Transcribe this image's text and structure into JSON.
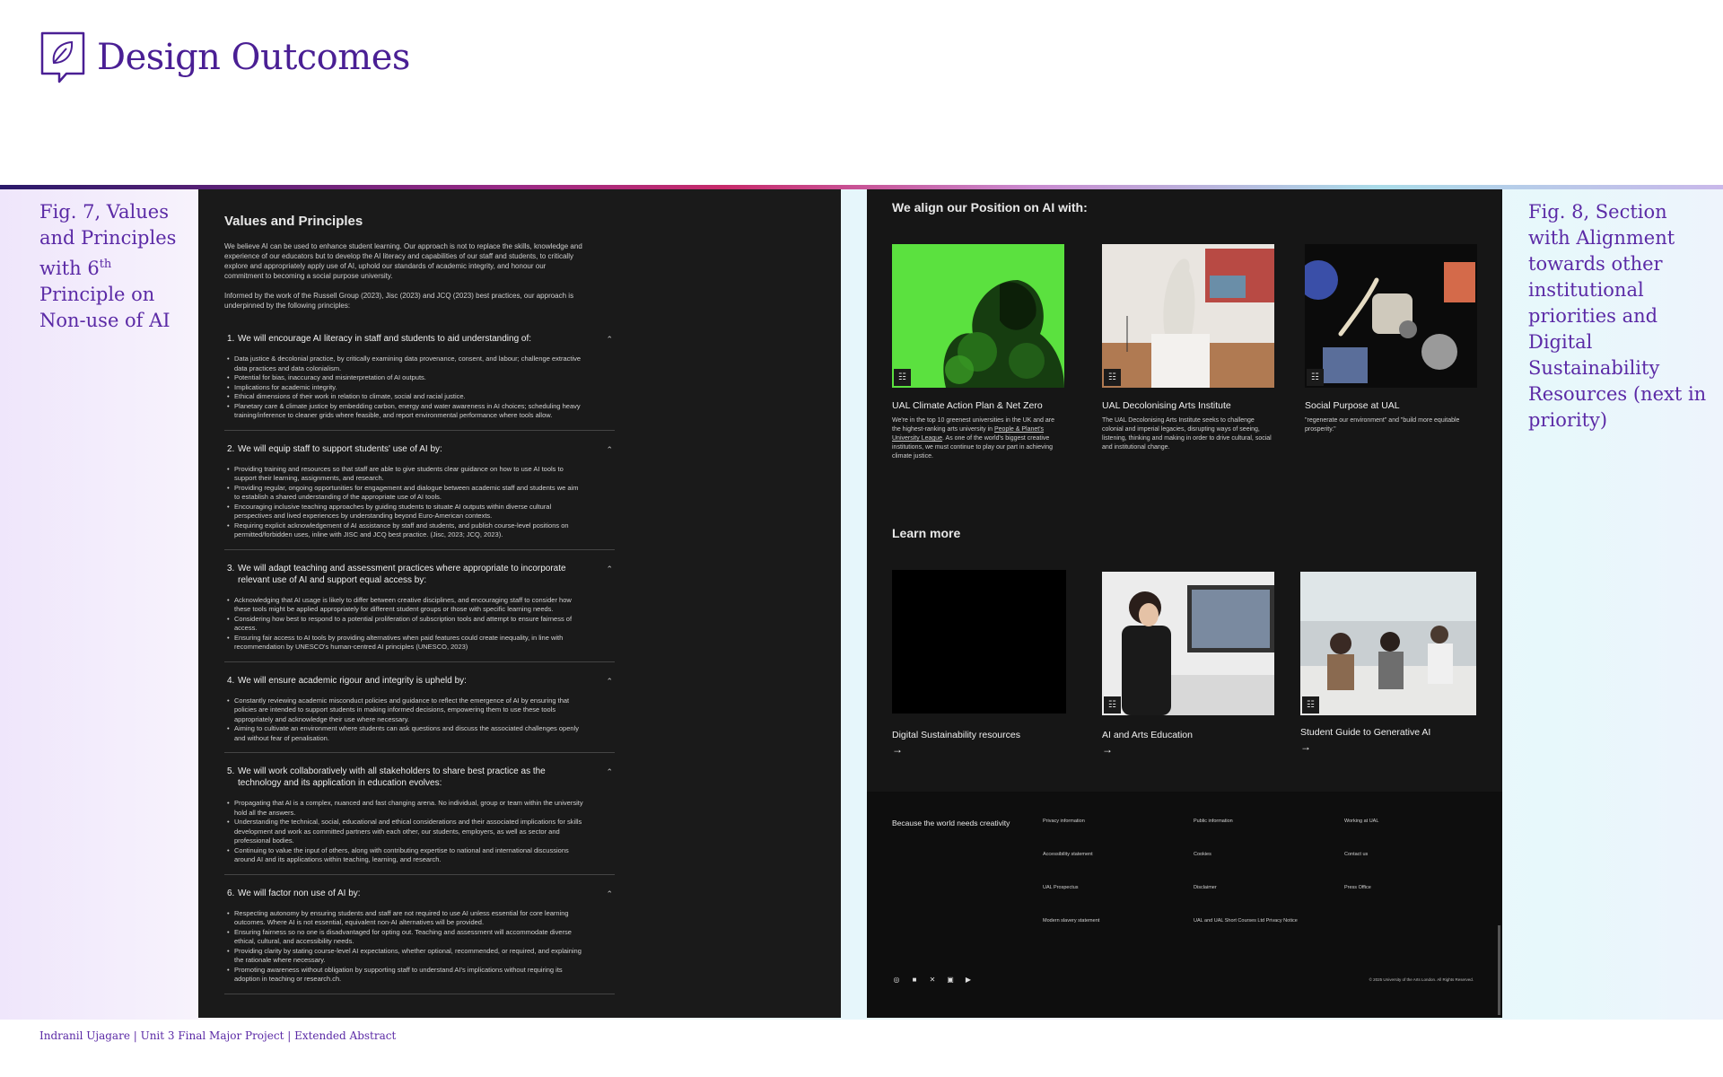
{
  "header": {
    "title": "Design Outcomes",
    "logo_icon": "leaf-speech-bubble-icon"
  },
  "captions": {
    "left": {
      "text": "Fig. 7, Values and Principles with 6",
      "sup": "th",
      "tail": " Principle on Non-use of AI"
    },
    "right": "Fig. 8, Section with Alignment towards other institutional priorities and Digital Sustainability Resources (next in priority)"
  },
  "values_page": {
    "title": "Values and Principles",
    "intro1": "We believe AI can be used to enhance student learning. Our approach is not to replace the skills, knowledge and experience of our educators but to develop the AI literacy and capabilities of our staff and students, to critically explore and appropriately apply use of AI, uphold our standards of academic integrity, and honour our commitment to becoming a social purpose university.",
    "intro2": "Informed by the work of the Russell Group (2023), Jisc (2023) and JCQ (2023) best practices, our approach is underpinned by the following principles:",
    "principles": [
      {
        "num": "1.",
        "heading": "We will encourage AI literacy in staff and students to aid understanding of:",
        "bullets": [
          "Data justice & decolonial practice, by critically examining data provenance, consent, and labour; challenge extractive data practices and data colonialism.",
          "Potential for bias, inaccuracy and misinterpretation of AI outputs.",
          "Implications for academic integrity.",
          "Ethical dimensions of their work in relation to climate, social and racial justice.",
          "Planetary care & climate justice by embedding carbon, energy and water awareness in AI choices; scheduling heavy training/inference to cleaner grids where feasible, and report environmental performance where tools allow."
        ]
      },
      {
        "num": "2.",
        "heading": "We will equip staff to support students' use of AI by:",
        "bullets": [
          "Providing training and resources so that staff are able to give students clear guidance on how to use AI tools to support their learning, assignments, and research.",
          "Providing regular, ongoing opportunities for engagement and dialogue between academic staff and students we aim to establish a shared understanding of the appropriate use of AI tools.",
          "Encouraging inclusive teaching approaches by guiding students to situate AI outputs within diverse cultural perspectives and lived experiences by understanding beyond Euro-American contexts.",
          "Requiring explicit acknowledgement of AI assistance by staff and students, and publish course-level positions on permitted/forbidden uses, inline with JISC and JCQ best practice. (Jisc, 2023; JCQ, 2023)."
        ]
      },
      {
        "num": "3.",
        "heading": "We will adapt teaching and assessment practices where appropriate to incorporate relevant use of AI and support equal access by:",
        "bullets": [
          "Acknowledging that AI usage is likely to differ between creative disciplines, and encouraging staff to consider how these tools might be applied appropriately for different student groups or those with specific learning needs.",
          "Considering how best to respond to a potential proliferation of subscription tools and attempt to ensure fairness of access.",
          "Ensuring fair access to AI tools by providing alternatives when paid features could create inequality, in line with recommendation by UNESCO's human-centred AI principles (UNESCO, 2023)"
        ]
      },
      {
        "num": "4.",
        "heading": "We will ensure academic rigour and integrity is upheld by:",
        "bullets": [
          "Constantly reviewing academic misconduct policies and guidance to reflect the emergence of AI by ensuring that policies are intended to support students in making informed decisions, empowering them to use these tools appropriately and acknowledge their use where necessary.",
          "Aiming to cultivate an environment where students can ask questions and discuss the associated challenges openly and without fear of penalisation."
        ]
      },
      {
        "num": "5.",
        "heading": "We will work collaboratively with all stakeholders to share best practice as the technology and its application in education evolves:",
        "bullets": [
          "Propagating that AI is a complex, nuanced and fast changing arena. No individual, group or team within the university hold all the answers.",
          "Understanding the technical, social, educational and ethical considerations and their associated implications for skills development and work as committed partners with each other, our students, employers, as well as sector and professional bodies.",
          "Continuing to value the input of others, along with contributing expertise to national and international discussions around AI and its applications within teaching, learning, and research."
        ]
      },
      {
        "num": "6.",
        "heading": "We will factor non use of AI by:",
        "bullets": [
          "Respecting autonomy by ensuring students and staff are not required to use AI unless essential for core learning outcomes. Where AI is not essential, equivalent non-AI alternatives will be provided.",
          "Ensuring fairness so no one is disadvantaged for opting out. Teaching and assessment will accommodate diverse ethical, cultural, and accessibility needs.",
          "Providing clarity by stating course-level AI expectations, whether optional, recommended, or required, and explaining the rationale where necessary.",
          "Promoting awareness without obligation by supporting staff to understand AI's implications without requiring its adoption in teaching or research.ch."
        ]
      }
    ]
  },
  "align_page": {
    "title": "We align our Position on AI with:",
    "cards": [
      {
        "title": "UAL Climate Action Plan & Net Zero",
        "desc_a": "We're in the top 10 greenest universities in the UK and are the highest-ranking arts university in ",
        "desc_link": "People & Planet's University League",
        "desc_b": ". As one of the world's biggest creative institutions, we must continue to play our part in achieving climate justice."
      },
      {
        "title": "UAL Decolonising Arts Institute",
        "desc": "The UAL Decolonising Arts Institute seeks to challenge colonial and imperial legacies, disrupting ways of seeing, listening, thinking and making in order to drive cultural, social and institutional change."
      },
      {
        "title": "Social Purpose at UAL",
        "desc": "\"regenerate our environment\" and \"build more equitable prosperity.\""
      }
    ],
    "learn_title": "Learn more",
    "learn": [
      {
        "title": "Digital Sustainability resources",
        "arrow": "→"
      },
      {
        "title": "AI and Arts Education",
        "arrow": "→"
      },
      {
        "title": "Student Guide to Generative AI",
        "arrow": "→"
      }
    ],
    "footer": {
      "tagline": "Because the world needs creativity",
      "links": [
        "Privacy information",
        "Public information",
        "Working at UAL",
        "Accessibility statement",
        "Cookies",
        "Contact us",
        "UAL Prospectus",
        "Disclaimer",
        "Press Office",
        "Modern slavery statement",
        "UAL and UAL Short Courses Ltd Privacy Notice"
      ],
      "copyright": "© 2025 University of the Arts London. All Rights Reserved.",
      "socials": [
        "instagram-icon",
        "facebook-icon",
        "x-icon",
        "linkedin-icon",
        "youtube-icon"
      ]
    }
  },
  "footnote": "Indranil Ujagare | Unit 3 Final Major Project | Extended Abstract"
}
